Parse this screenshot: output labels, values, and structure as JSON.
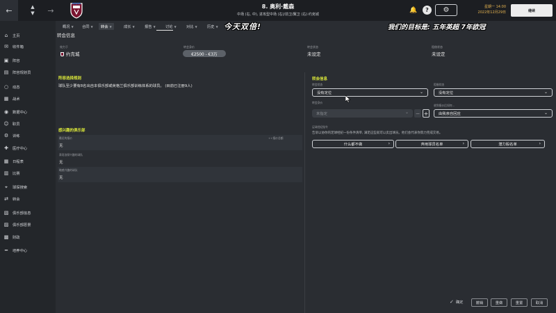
{
  "topbar": {
    "back_icon": "arrow-left-icon",
    "forward_icon": "arrow-right-icon",
    "player_name": "8. 奥利·戴森",
    "player_subtitle": "中场 (右, 中), 进攻型中场 (右)/前卫/翼卫 (右)·约克城",
    "date_time": "星期一 14:00",
    "date": "2022年12月29日",
    "continue_label": "继续"
  },
  "sidebar": {
    "items": [
      {
        "icon": "home-icon",
        "label": "主页"
      },
      {
        "icon": "inbox-icon",
        "label": "收件箱"
      },
      {
        "icon": "squad-icon",
        "label": "阵容"
      },
      {
        "icon": "squad-plan-icon",
        "label": "阵容规划员"
      },
      {
        "icon": "dynamics-icon",
        "label": "动态"
      },
      {
        "icon": "tactics-icon",
        "label": "战术"
      },
      {
        "icon": "data-hub-icon",
        "label": "数据中心"
      },
      {
        "icon": "staff-icon",
        "label": "职员"
      },
      {
        "icon": "training-icon",
        "label": "训练"
      },
      {
        "icon": "medical-icon",
        "label": "医疗中心"
      },
      {
        "icon": "schedule-icon",
        "label": "日程表"
      },
      {
        "icon": "competitions-icon",
        "label": "比赛"
      },
      {
        "icon": "scouting-icon",
        "label": "球探搜索"
      },
      {
        "icon": "transfers-icon",
        "label": "转会"
      },
      {
        "icon": "club-info-icon",
        "label": "俱乐部信息"
      },
      {
        "icon": "club-vision-icon",
        "label": "俱乐部愿景"
      },
      {
        "icon": "finances-icon",
        "label": "财政"
      },
      {
        "icon": "dev-centre-icon",
        "label": "培养中心"
      }
    ]
  },
  "tabs": [
    {
      "label": "概况",
      "caret": true
    },
    {
      "label": "合同",
      "caret": true
    },
    {
      "label": "转会",
      "caret": true,
      "active": true
    },
    {
      "label": "成长",
      "caret": true
    },
    {
      "label": "报告",
      "caret": true
    },
    {
      "label": "讨论",
      "caret": true
    },
    {
      "label": "对比",
      "caret": true
    },
    {
      "label": "历史",
      "caret": true
    }
  ],
  "overlays": {
    "line1": "今天双倍!",
    "line2": "我们的目标是: 五年英超 7年欧冠"
  },
  "transfer_info": {
    "section_title": "转会信息",
    "affiliation_label": "效力于",
    "affiliation_value": "约克城",
    "value_label": "转会身价",
    "value_value": "€2500 - €3万",
    "transfer_status_label": "转会状态",
    "transfer_status_value": "未设定",
    "loan_status_label": "租借状态",
    "loan_status_value": "未设定"
  },
  "left_panel": {
    "rule_title": "阵容选择规则",
    "rule_text": "球队至少要有8名出自本俱乐部或英格兰俱乐部训练体系的球员。 (目前已注册9人)",
    "interested_title": "感兴趣的俱乐部",
    "rows": [
      {
        "label": "最近的报价",
        "action": "++报价总额",
        "value": "无"
      },
      {
        "label": "表现浓厚兴趣的球队",
        "action": "",
        "value": "无"
      },
      {
        "label": "略感兴趣的球队",
        "action": "",
        "value": "无"
      }
    ]
  },
  "right_panel": {
    "title": "转会信息",
    "transfer_status_label": "转会状态",
    "transfer_status_value": "没有定位",
    "loan_status_label": "租借状态",
    "loan_status_value": "没有定位",
    "fee_label": "转会身价",
    "fee_value": "未指定",
    "minus": "−",
    "plus": "+",
    "handle_label": "收到报价后如何...",
    "handle_value": "由我亲自回应",
    "filter_label": "足球经纪指令",
    "filter_desc": "告诉以协你的足球经纪一份条件清单, 满足这些就可以卖出球员。他们会代表你努力完成交易。",
    "btn1": "什么都不做",
    "btn2": "弃用球员名单",
    "btn3": "潜力股名单"
  },
  "bottom": {
    "confirm": "确定",
    "btn1": "撤销",
    "btn2": "重做",
    "btn3": "重置",
    "btn4": "取消"
  },
  "colors": {
    "accent_yellow": "#d9e63a",
    "date_orange": "#e6b450",
    "club_maroon": "#7a1530"
  }
}
